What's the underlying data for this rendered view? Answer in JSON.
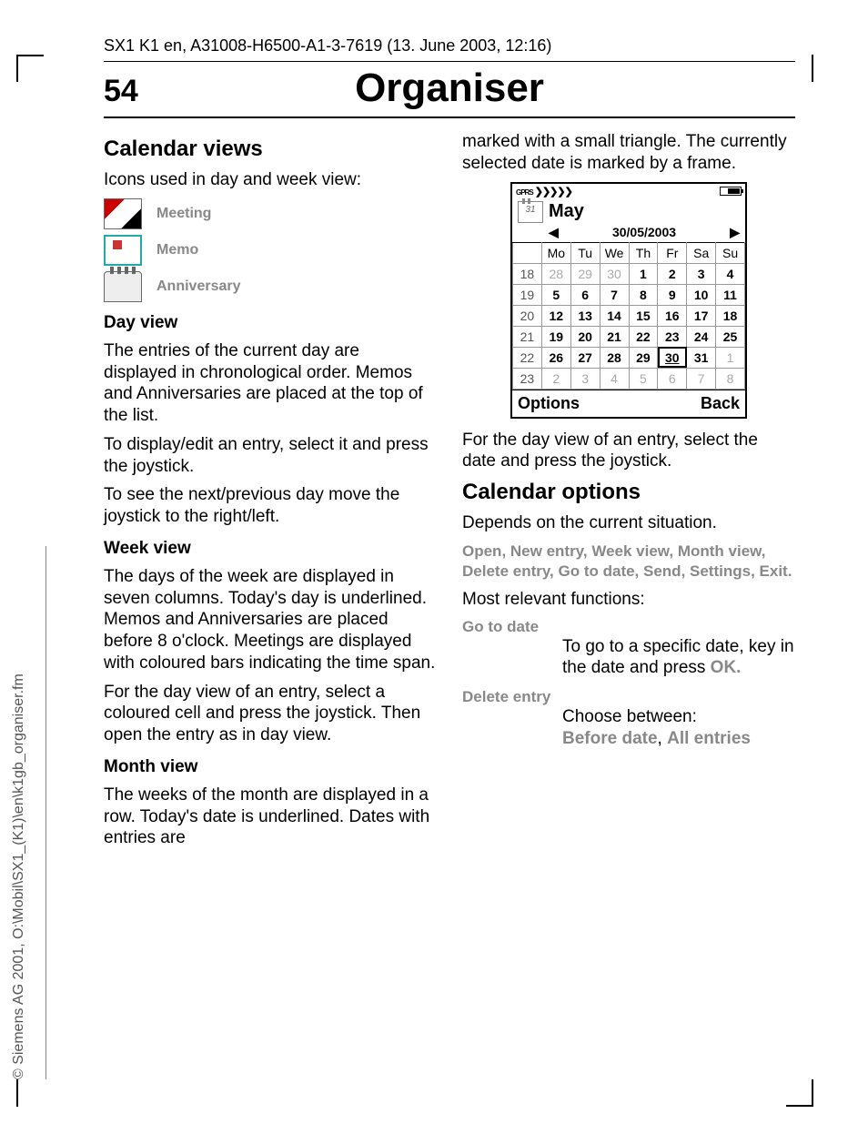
{
  "running_head": "SX1 K1 en, A31008-H6500-A1-3-7619 (13. June 2003, 12:16)",
  "page_number": "54",
  "chapter_title": "Organiser",
  "side_text": "© Siemens AG 2001, O:\\Mobil\\SX1_(K1)\\en\\k1gb_organiser.fm",
  "left": {
    "h_calendar_views": "Calendar views",
    "p_icons_intro": "Icons used in day and week view:",
    "icon_labels": {
      "meeting": "Meeting",
      "memo": "Memo",
      "anniversary": "Anniversary"
    },
    "h_day_view": "Day view",
    "p_day1": "The entries of the current day are displayed in chronological order. Memos and Anniversaries are placed at the top of the list.",
    "p_day2": "To display/edit an entry, select it and press the joystick.",
    "p_day3": "To see the next/previous day move the joystick to the right/left.",
    "h_week_view": "Week view",
    "p_week1": "The days of the week are displayed in seven columns. Today's day is underlined. Memos and Anniversaries are placed before 8 o'clock. Meetings are displayed with coloured bars indicating the time span.",
    "p_week2": "For the day view of an entry, select a coloured cell and press the joystick. Then open the entry as in day view.",
    "h_month_view": "Month view",
    "p_month1": "The weeks of the month are displayed in a row. Today's date is underlined. Dates with entries are"
  },
  "right": {
    "p_month_cont": "marked with a small triangle. The currently selected date is marked by a frame.",
    "p_after_phone": "For the day view of an entry, select the date and press the joystick.",
    "h_calendar_options": "Calendar options",
    "p_depends": "Depends on the current situation.",
    "options_list": "Open, New entry, Week view, Month view, Delete entry, Go to date, Send, Settings, Exit.",
    "p_relevant": "Most relevant functions:",
    "goto": {
      "term": "Go to date",
      "body_pre": "To go to a specific date, key in the date and press ",
      "ok": "OK."
    },
    "delete": {
      "term": "Delete entry",
      "body_pre": "Choose between:",
      "opt1": "Before date",
      "sep": ", ",
      "opt2": "All entries"
    }
  },
  "phone": {
    "signal_label": "GPRS",
    "cal_icon_text": "31",
    "month": "May",
    "date": "30/05/2003",
    "arrow_left": "◀",
    "arrow_right": "▶",
    "dow": [
      "Mo",
      "Tu",
      "We",
      "Th",
      "Fr",
      "Sa",
      "Su"
    ],
    "weeks": [
      "18",
      "19",
      "20",
      "21",
      "22",
      "23"
    ],
    "grid": [
      [
        {
          "v": "28",
          "c": "out"
        },
        {
          "v": "29",
          "c": "out"
        },
        {
          "v": "30",
          "c": "out"
        },
        {
          "v": "1",
          "c": "bold"
        },
        {
          "v": "2",
          "c": "bold"
        },
        {
          "v": "3",
          "c": "bold"
        },
        {
          "v": "4",
          "c": "bold"
        }
      ],
      [
        {
          "v": "5",
          "c": "bold"
        },
        {
          "v": "6",
          "c": "bold"
        },
        {
          "v": "7",
          "c": "bold"
        },
        {
          "v": "8",
          "c": "bold"
        },
        {
          "v": "9",
          "c": "bold"
        },
        {
          "v": "10",
          "c": "bold"
        },
        {
          "v": "11",
          "c": "bold"
        }
      ],
      [
        {
          "v": "12",
          "c": "bold"
        },
        {
          "v": "13",
          "c": "bold"
        },
        {
          "v": "14",
          "c": "bold"
        },
        {
          "v": "15",
          "c": "bold"
        },
        {
          "v": "16",
          "c": "bold"
        },
        {
          "v": "17",
          "c": "bold"
        },
        {
          "v": "18",
          "c": "bold"
        }
      ],
      [
        {
          "v": "19",
          "c": "bold"
        },
        {
          "v": "20",
          "c": "bold"
        },
        {
          "v": "21",
          "c": "bold"
        },
        {
          "v": "22",
          "c": "bold"
        },
        {
          "v": "23",
          "c": "bold"
        },
        {
          "v": "24",
          "c": "bold"
        },
        {
          "v": "25",
          "c": "bold"
        }
      ],
      [
        {
          "v": "26",
          "c": "bold"
        },
        {
          "v": "27",
          "c": "bold"
        },
        {
          "v": "28",
          "c": "bold"
        },
        {
          "v": "29",
          "c": "bold"
        },
        {
          "v": "30",
          "c": "sel"
        },
        {
          "v": "31",
          "c": "bold"
        },
        {
          "v": "1",
          "c": "out"
        }
      ],
      [
        {
          "v": "2",
          "c": "out"
        },
        {
          "v": "3",
          "c": "out"
        },
        {
          "v": "4",
          "c": "out"
        },
        {
          "v": "5",
          "c": "out"
        },
        {
          "v": "6",
          "c": "out"
        },
        {
          "v": "7",
          "c": "out"
        },
        {
          "v": "8",
          "c": "out"
        }
      ]
    ],
    "soft_left": "Options",
    "soft_right": "Back"
  }
}
